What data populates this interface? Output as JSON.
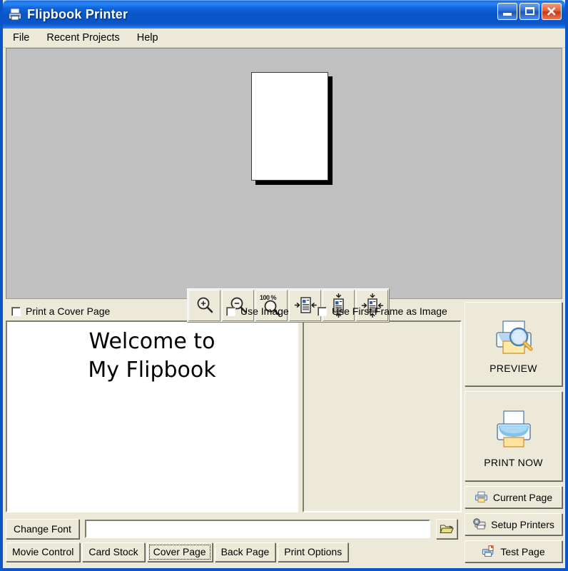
{
  "window": {
    "title": "Flipbook Printer",
    "title_icon": "printer-icon",
    "caption_buttons": [
      {
        "name": "minimize",
        "label": "Minimize"
      },
      {
        "name": "maximize",
        "label": "Maximize"
      },
      {
        "name": "close",
        "label": "Close"
      }
    ]
  },
  "menubar": {
    "items": [
      {
        "label": "File"
      },
      {
        "label": "Recent Projects"
      },
      {
        "label": "Help"
      }
    ]
  },
  "preview": {
    "background_color": "#c0c0c0",
    "page": {
      "orientation": "portrait",
      "content": ""
    },
    "toolbar": [
      {
        "name": "zoom-in",
        "icon": "magnifier-plus-icon",
        "tooltip": "Zoom In"
      },
      {
        "name": "zoom-out",
        "icon": "magnifier-minus-icon",
        "tooltip": "Zoom Out"
      },
      {
        "name": "zoom-100",
        "icon": "magnifier-icon",
        "badge": "100 %",
        "tooltip": "Actual Size"
      },
      {
        "name": "fit-width",
        "icon": "fit-width-icon",
        "tooltip": "Fit Width"
      },
      {
        "name": "fit-height",
        "icon": "fit-height-icon",
        "tooltip": "Fit Height"
      },
      {
        "name": "fit-page",
        "icon": "fit-page-icon",
        "tooltip": "Fit Page"
      }
    ]
  },
  "cover_page": {
    "checkboxes": [
      {
        "name": "print-a-cover-page",
        "label": "Print a Cover Page",
        "checked": false
      },
      {
        "name": "use-image",
        "label": "Use Image",
        "checked": false
      },
      {
        "name": "use-first-frame-as-image",
        "label": "Use First Frame as Image",
        "checked": false
      }
    ],
    "text": "Welcome to\nMy Flipbook",
    "image_panel": {
      "empty": true
    },
    "change_font_label": "Change Font",
    "path_value": "",
    "path_placeholder": "",
    "browse_icon": "open-folder-icon"
  },
  "tabs": [
    {
      "label": "Movie Control",
      "active": false
    },
    {
      "label": "Card Stock",
      "active": false
    },
    {
      "label": "Cover Page",
      "active": true
    },
    {
      "label": "Back Page",
      "active": false
    },
    {
      "label": "Print Options",
      "active": false
    }
  ],
  "actions": {
    "preview": {
      "label": "PREVIEW",
      "icon": "printer-magnifier-icon"
    },
    "print_now": {
      "label": "PRINT NOW",
      "icon": "printer-icon"
    },
    "current_page": {
      "label": "Current Page",
      "icon": "printer-small-icon"
    },
    "setup_printers": {
      "label": "Setup Printers",
      "icon": "printer-settings-icon"
    },
    "test_page": {
      "label": "Test Page",
      "icon": "printer-page-icon"
    }
  },
  "colors": {
    "titlebar": "#0a55c8",
    "panel": "#ece9d8",
    "preview_bg": "#c0c0c0",
    "text": "#000000"
  }
}
